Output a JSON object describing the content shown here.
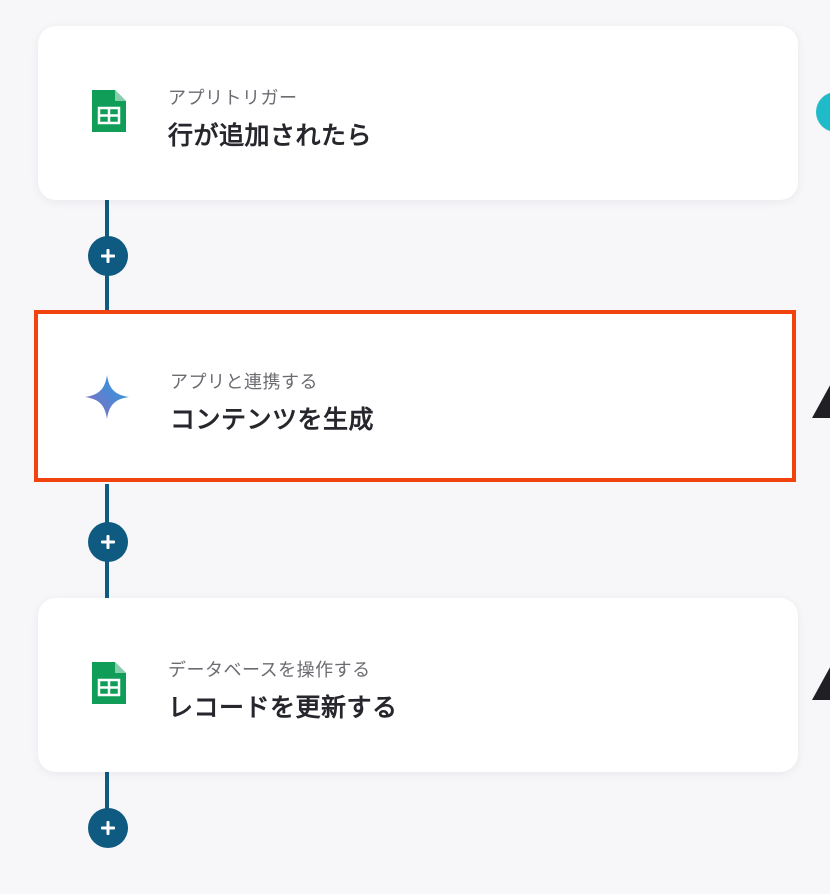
{
  "flow": {
    "steps": [
      {
        "subtitle": "アプリトリガー",
        "title": "行が追加されたら",
        "app_icon": "google-sheets-icon"
      },
      {
        "subtitle": "アプリと連携する",
        "title": "コンテンツを生成",
        "app_icon": "gemini-sparkle-icon"
      },
      {
        "subtitle": "データベースを操作する",
        "title": "レコードを更新する",
        "app_icon": "google-sheets-icon"
      }
    ],
    "add_step_icon": "plus-icon"
  },
  "colors": {
    "background": "#f7f6f9",
    "connector": "#0e5a80",
    "selection_border": "#f2430e",
    "sheets_green": "#0f9d58",
    "edge_indicator_teal": "#1fbbc8"
  }
}
